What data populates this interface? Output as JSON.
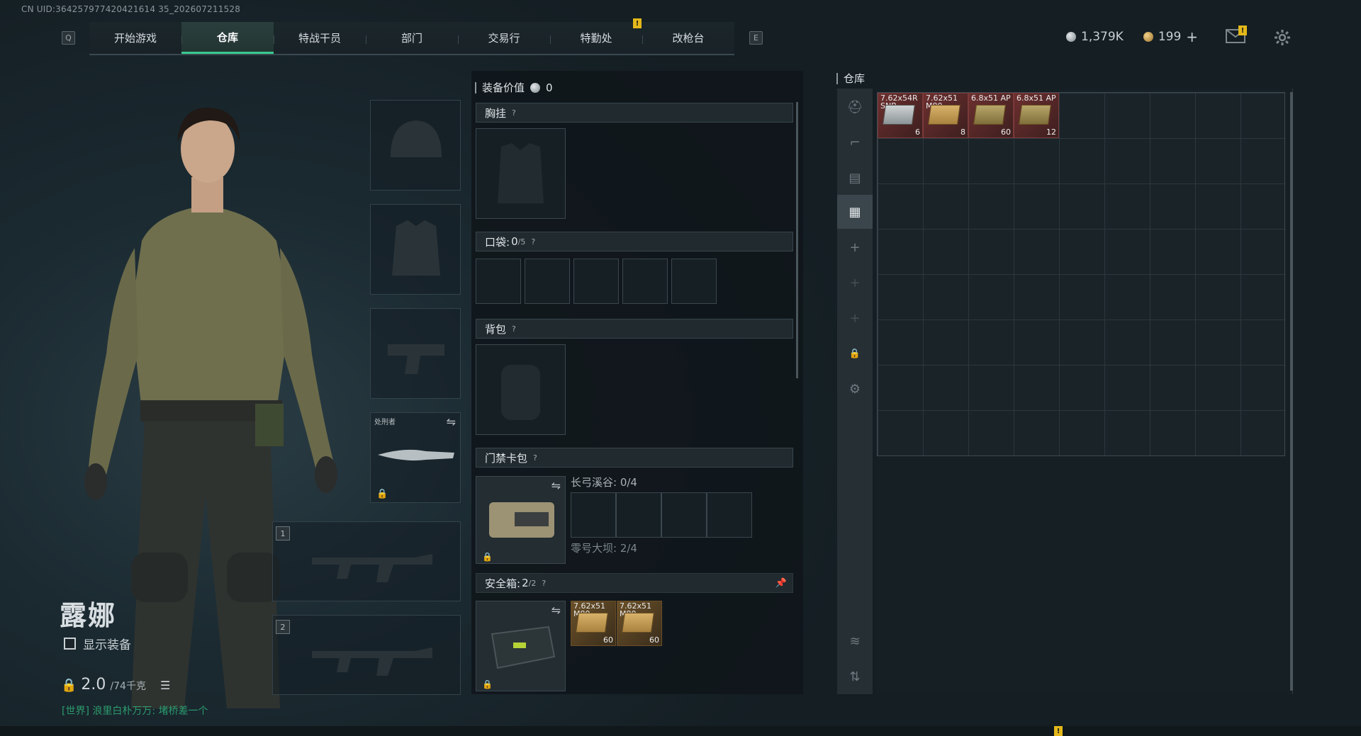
{
  "uid": "CN UID:364257977420421614 35_202607211528",
  "nav": {
    "left_key": "Q",
    "right_key": "E",
    "tabs": [
      "开始游戏",
      "仓库",
      "特战干员",
      "部门",
      "交易行",
      "特勤处",
      "改枪台"
    ],
    "active_tab": "仓库"
  },
  "currency": {
    "silver": "1,379K",
    "gold": "199",
    "add": "+"
  },
  "operator": {
    "name": "露娜",
    "show_equipment_label": "显示装备",
    "weight_value": "2.0",
    "weight_max": "/74千克"
  },
  "chat": {
    "channel": "[世界]",
    "text": "浪里白朴万万: 堵桥差一个"
  },
  "equip_slots": {
    "melee_label": "处刑者",
    "primary_1": "1",
    "primary_2": "2"
  },
  "middle": {
    "equip_value_label": "装备价值",
    "equip_value": "0",
    "chest_rig": "胸挂",
    "pocket": "口袋:",
    "pocket_count": "0",
    "pocket_max": "/5",
    "backpack": "背包",
    "keycard_case": "门禁卡包",
    "keycard_map1": "长弓溪谷: 0/4",
    "keycard_map2": "零号大坝: 2/4",
    "safe_box": "安全箱:",
    "safe_count": "2",
    "safe_max": "/2",
    "question": "?",
    "safe_items": [
      {
        "name": "7.62x51 M80",
        "count": "60"
      },
      {
        "name": "7.62x51 M80",
        "count": "60"
      }
    ]
  },
  "warehouse": {
    "title": "仓库",
    "items": [
      {
        "name": "7.62x54R SNB",
        "count": "6",
        "color": "red"
      },
      {
        "name": "7.62x51 M80",
        "count": "8",
        "color": "red"
      },
      {
        "name": "6.8x51 AP",
        "count": "60",
        "color": "red"
      },
      {
        "name": "6.8x51 AP",
        "count": "12",
        "color": "red"
      }
    ]
  },
  "colors": {
    "accent": "#39c98f",
    "warning": "#e3b81a",
    "chat": "#2c9b6e"
  }
}
